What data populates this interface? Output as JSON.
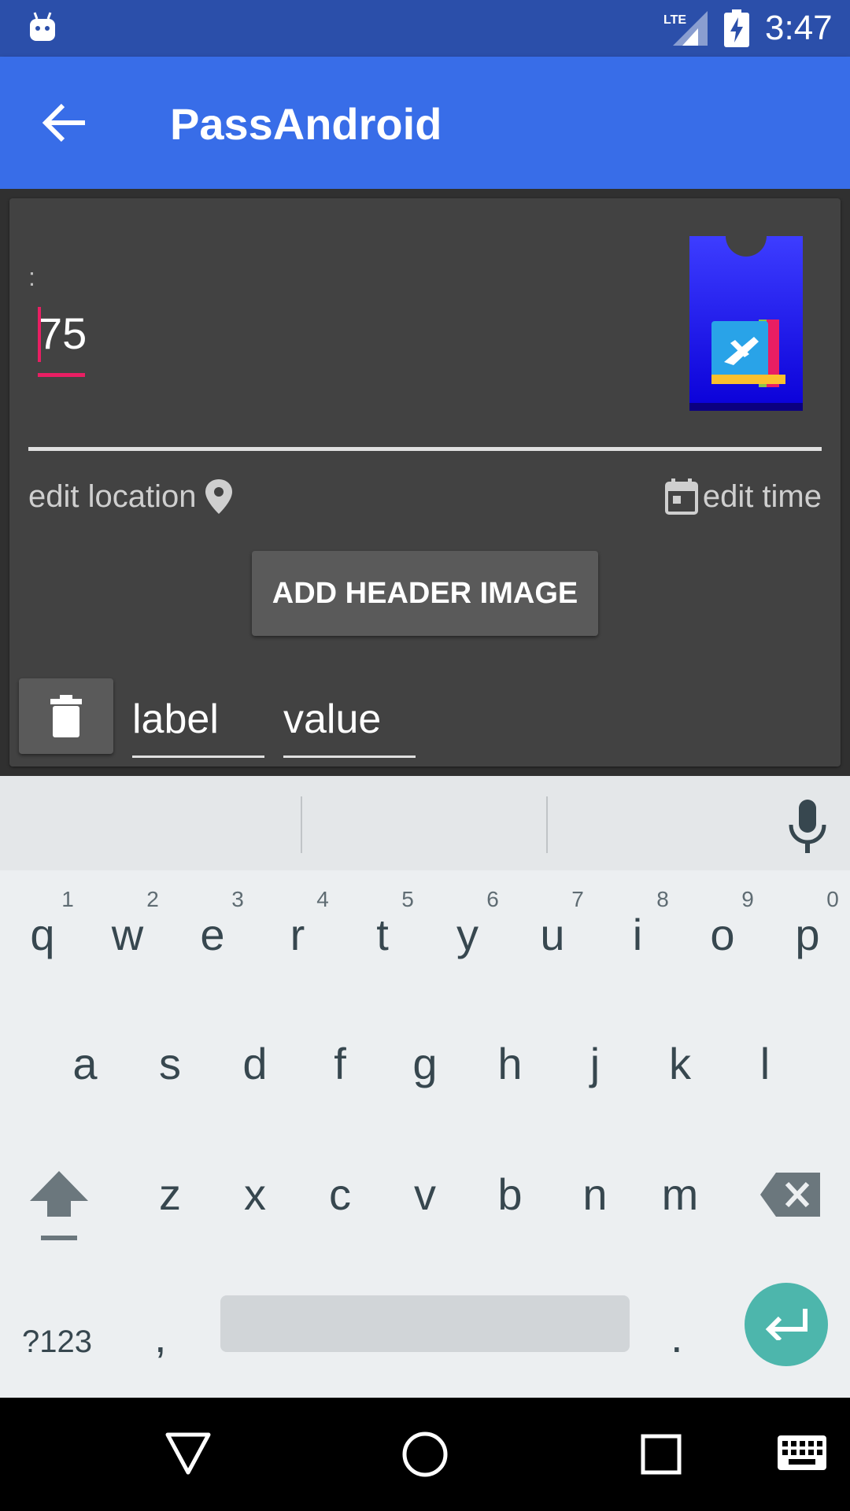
{
  "status_bar": {
    "time": "3:47",
    "network": "LTE",
    "icons": [
      "android-debug-icon",
      "lte-signal-icon",
      "battery-charging-icon"
    ]
  },
  "app_bar": {
    "title": "PassAndroid",
    "back_icon": "arrow-back-icon"
  },
  "pass_editor": {
    "field_prefix": ":",
    "value_input": "75",
    "edit_location_label": "edit location",
    "edit_location_icon": "location-pin-icon",
    "edit_time_label": "edit time",
    "edit_time_icon": "calendar-icon",
    "add_header_image_label": "ADD HEADER IMAGE",
    "field_row": {
      "delete_icon": "trash-icon",
      "label_placeholder": "label",
      "value_placeholder": "value"
    }
  },
  "keyboard": {
    "row1": [
      "q",
      "w",
      "e",
      "r",
      "t",
      "y",
      "u",
      "i",
      "o",
      "p"
    ],
    "row1_hints": [
      "1",
      "2",
      "3",
      "4",
      "5",
      "6",
      "7",
      "8",
      "9",
      "0"
    ],
    "row2": [
      "a",
      "s",
      "d",
      "f",
      "g",
      "h",
      "j",
      "k",
      "l"
    ],
    "row3": [
      "z",
      "x",
      "c",
      "v",
      "b",
      "n",
      "m"
    ],
    "symbols_label": "?123",
    "comma": ",",
    "period": ".",
    "mic_icon": "mic-icon",
    "shift_icon": "shift-icon",
    "backspace_icon": "backspace-icon",
    "enter_icon": "enter-icon",
    "enter_color": "#4db6ac"
  },
  "colors": {
    "status_bar": "#2b4faa",
    "app_bar": "#386de8",
    "accent": "#e91e63",
    "card_bg": "#424242"
  },
  "nav_bar": {
    "icons": [
      "back-triangle-icon",
      "home-circle-icon",
      "recents-square-icon",
      "keyboard-switch-icon"
    ]
  }
}
